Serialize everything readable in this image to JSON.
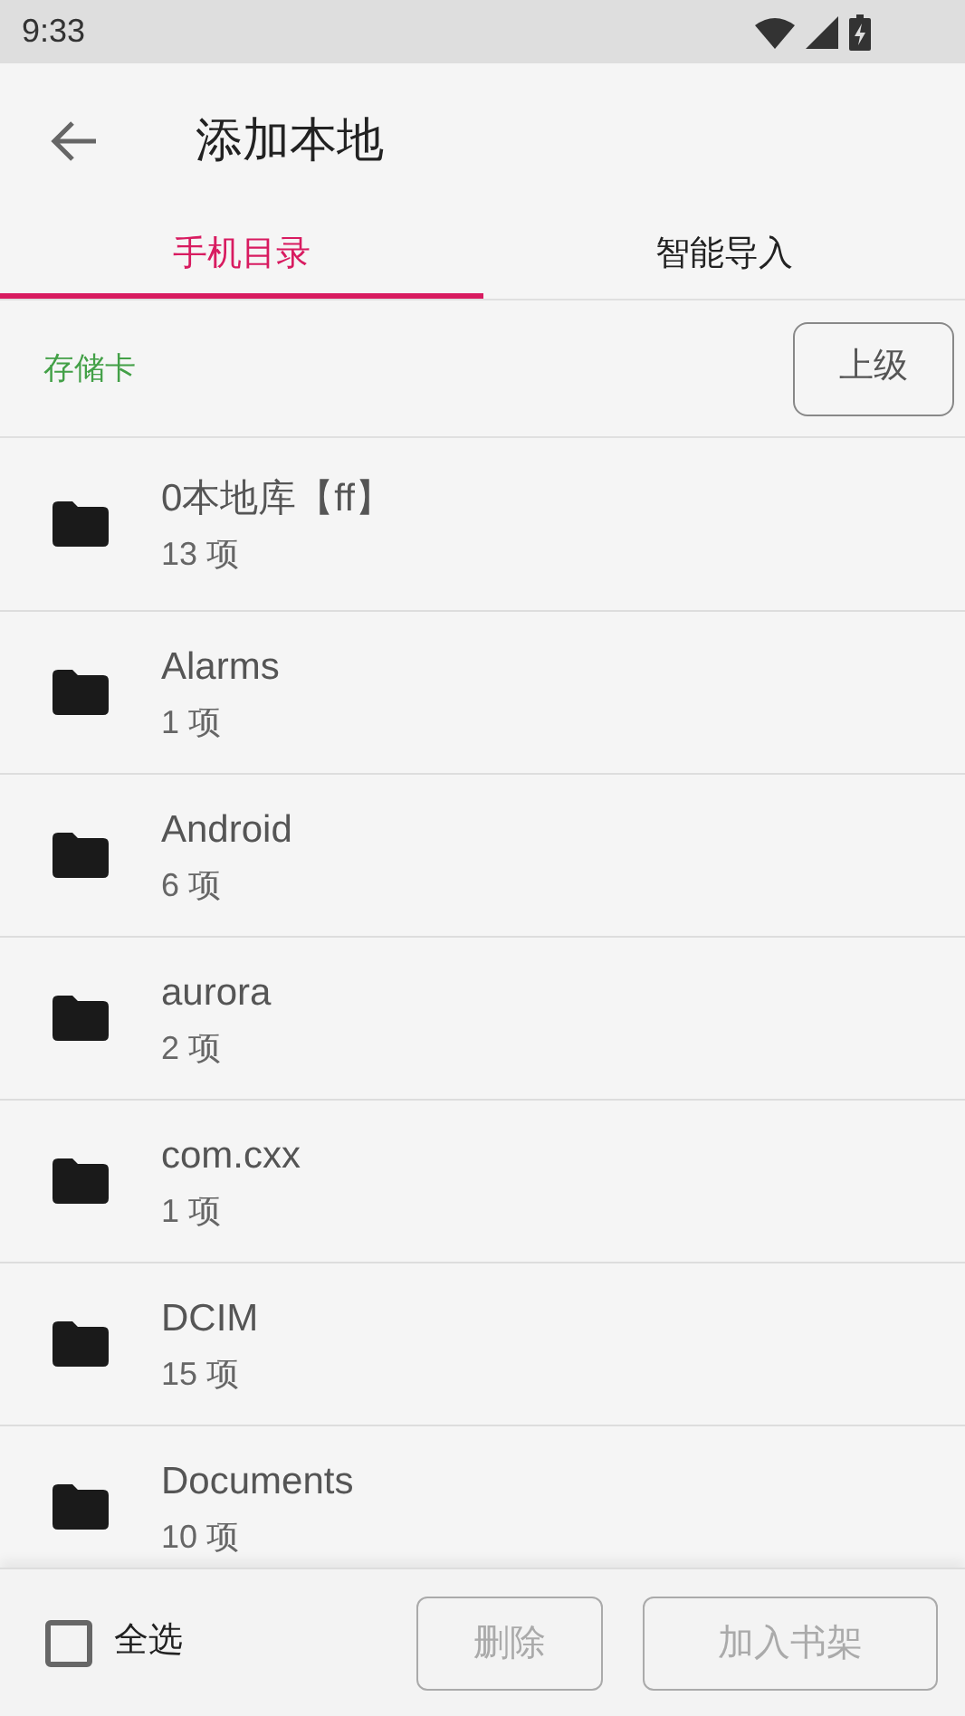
{
  "status_bar": {
    "time": "9:33"
  },
  "app_bar": {
    "title": "添加本地"
  },
  "tabs": [
    {
      "label": "手机目录",
      "selected": true
    },
    {
      "label": "智能导入",
      "selected": false
    }
  ],
  "path_bar": {
    "path": "存储卡",
    "up_button": "上级"
  },
  "folders": [
    {
      "name": "0本地库【ff】",
      "count": "13 项"
    },
    {
      "name": "Alarms",
      "count": "1 项"
    },
    {
      "name": "Android",
      "count": "6 项"
    },
    {
      "name": "aurora",
      "count": "2 项"
    },
    {
      "name": "com.cxx",
      "count": "1 项"
    },
    {
      "name": "DCIM",
      "count": "15 项"
    },
    {
      "name": "Documents",
      "count": "10 项"
    }
  ],
  "bottom_bar": {
    "select_all": {
      "label": "全选",
      "checked": false
    },
    "buttons": [
      {
        "label": "删除",
        "disabled": true
      },
      {
        "label": "加入书架",
        "disabled": true
      }
    ]
  }
}
